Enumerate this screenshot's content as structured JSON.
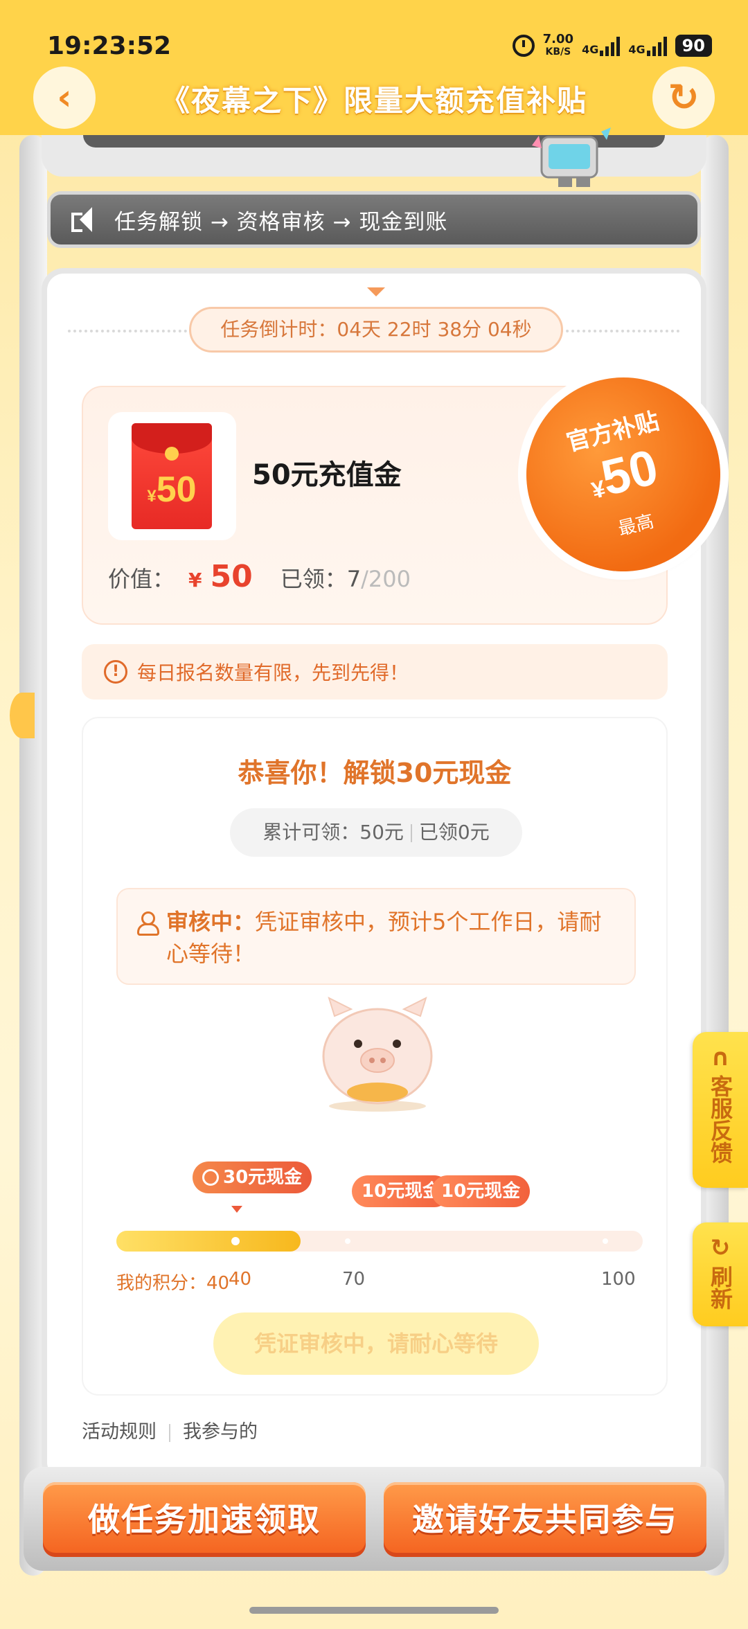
{
  "status_bar": {
    "time": "19:23:52",
    "speed_value": "7.00",
    "speed_unit": "KB/S",
    "net1": "4G",
    "net2": "4G",
    "battery": "90"
  },
  "header": {
    "title": "《夜幕之下》限量大额充值补贴",
    "back_icon": "chevron-left-icon",
    "refresh_icon": "refresh-icon",
    "bg_color": "#ffd34a"
  },
  "notice": {
    "text": "任务解锁 → 资格审核 → 现金到账"
  },
  "countdown": {
    "text": "任务倒计时：04天 22时 38分 04秒"
  },
  "prize": {
    "envelope_amount": "50",
    "envelope_currency": "¥",
    "name": "50元充值金",
    "value_label": "价值：",
    "value_currency": "¥",
    "value_amount": "50",
    "claimed_label": "已领：",
    "claimed_count": "7",
    "claimed_total": "/200"
  },
  "badge": {
    "line1": "官方补贴",
    "currency": "¥",
    "amount": "50",
    "line3": "最高"
  },
  "tip": {
    "text": "每日报名数量有限，先到先得！"
  },
  "task": {
    "congrats": "恭喜你！解锁30元现金",
    "cum_label": "累计可领：50元",
    "cum_claimed": "已领0元",
    "review_label": "审核中：",
    "review_text": "凭证审核中，预计5个工作日，请耐心等待！",
    "milestones": [
      {
        "label": "30元现金",
        "score": 40,
        "active": true
      },
      {
        "label": "10元现金",
        "score": 70,
        "active": false
      },
      {
        "label": "10元现金",
        "score": 100,
        "active": false
      }
    ],
    "my_score_label": "我的积分：40",
    "scale_40": "40",
    "scale_70": "70",
    "scale_100": "100",
    "progress_fraction": 0.35,
    "button_label": "凭证审核中，请耐心等待"
  },
  "links": {
    "rules": "活动规则",
    "mine": "我参与的"
  },
  "side_tabs": {
    "service": "客服反馈",
    "refresh": "刷新"
  },
  "bottom": {
    "left_button": "做任务加速领取",
    "right_button": "邀请好友共同参与"
  }
}
